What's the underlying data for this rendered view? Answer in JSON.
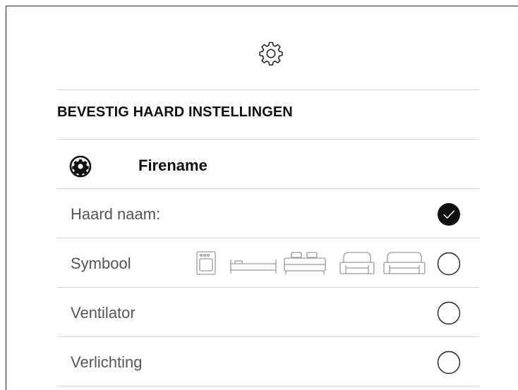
{
  "header": {
    "icon": "settings-outline-icon"
  },
  "section": {
    "title": "BEVESTIG HAARD INSTELLINGEN"
  },
  "fire": {
    "icon": "settings-filled-icon",
    "name": "Firename"
  },
  "rows": [
    {
      "label": "Haard naam:",
      "checked": true
    },
    {
      "label": "Symbool",
      "checked": false,
      "symbols": [
        "oven-icon",
        "single-bed-icon",
        "double-bed-icon",
        "armchair-icon",
        "sofa-icon"
      ]
    },
    {
      "label": "Ventilator",
      "checked": false
    },
    {
      "label": "Verlichting",
      "checked": false
    }
  ],
  "colors": {
    "text": "#555555",
    "heading": "#111111",
    "divider": "#d6d6d6",
    "check_fill": "#111111"
  }
}
